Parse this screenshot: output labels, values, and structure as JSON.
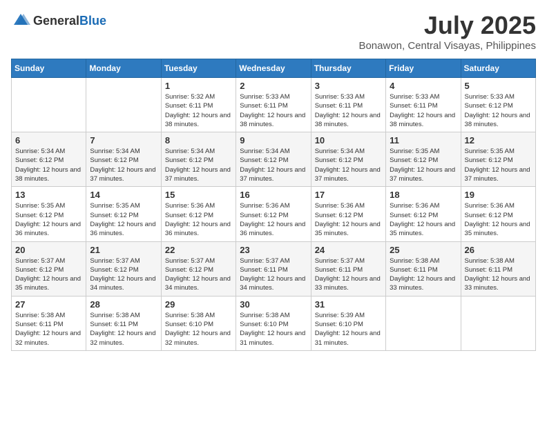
{
  "header": {
    "logo_general": "General",
    "logo_blue": "Blue",
    "title": "July 2025",
    "subtitle": "Bonawon, Central Visayas, Philippines"
  },
  "days_of_week": [
    "Sunday",
    "Monday",
    "Tuesday",
    "Wednesday",
    "Thursday",
    "Friday",
    "Saturday"
  ],
  "weeks": [
    [
      {
        "day": "",
        "sunrise": "",
        "sunset": "",
        "daylight": ""
      },
      {
        "day": "",
        "sunrise": "",
        "sunset": "",
        "daylight": ""
      },
      {
        "day": "1",
        "sunrise": "Sunrise: 5:32 AM",
        "sunset": "Sunset: 6:11 PM",
        "daylight": "Daylight: 12 hours and 38 minutes."
      },
      {
        "day": "2",
        "sunrise": "Sunrise: 5:33 AM",
        "sunset": "Sunset: 6:11 PM",
        "daylight": "Daylight: 12 hours and 38 minutes."
      },
      {
        "day": "3",
        "sunrise": "Sunrise: 5:33 AM",
        "sunset": "Sunset: 6:11 PM",
        "daylight": "Daylight: 12 hours and 38 minutes."
      },
      {
        "day": "4",
        "sunrise": "Sunrise: 5:33 AM",
        "sunset": "Sunset: 6:11 PM",
        "daylight": "Daylight: 12 hours and 38 minutes."
      },
      {
        "day": "5",
        "sunrise": "Sunrise: 5:33 AM",
        "sunset": "Sunset: 6:12 PM",
        "daylight": "Daylight: 12 hours and 38 minutes."
      }
    ],
    [
      {
        "day": "6",
        "sunrise": "Sunrise: 5:34 AM",
        "sunset": "Sunset: 6:12 PM",
        "daylight": "Daylight: 12 hours and 38 minutes."
      },
      {
        "day": "7",
        "sunrise": "Sunrise: 5:34 AM",
        "sunset": "Sunset: 6:12 PM",
        "daylight": "Daylight: 12 hours and 37 minutes."
      },
      {
        "day": "8",
        "sunrise": "Sunrise: 5:34 AM",
        "sunset": "Sunset: 6:12 PM",
        "daylight": "Daylight: 12 hours and 37 minutes."
      },
      {
        "day": "9",
        "sunrise": "Sunrise: 5:34 AM",
        "sunset": "Sunset: 6:12 PM",
        "daylight": "Daylight: 12 hours and 37 minutes."
      },
      {
        "day": "10",
        "sunrise": "Sunrise: 5:34 AM",
        "sunset": "Sunset: 6:12 PM",
        "daylight": "Daylight: 12 hours and 37 minutes."
      },
      {
        "day": "11",
        "sunrise": "Sunrise: 5:35 AM",
        "sunset": "Sunset: 6:12 PM",
        "daylight": "Daylight: 12 hours and 37 minutes."
      },
      {
        "day": "12",
        "sunrise": "Sunrise: 5:35 AM",
        "sunset": "Sunset: 6:12 PM",
        "daylight": "Daylight: 12 hours and 37 minutes."
      }
    ],
    [
      {
        "day": "13",
        "sunrise": "Sunrise: 5:35 AM",
        "sunset": "Sunset: 6:12 PM",
        "daylight": "Daylight: 12 hours and 36 minutes."
      },
      {
        "day": "14",
        "sunrise": "Sunrise: 5:35 AM",
        "sunset": "Sunset: 6:12 PM",
        "daylight": "Daylight: 12 hours and 36 minutes."
      },
      {
        "day": "15",
        "sunrise": "Sunrise: 5:36 AM",
        "sunset": "Sunset: 6:12 PM",
        "daylight": "Daylight: 12 hours and 36 minutes."
      },
      {
        "day": "16",
        "sunrise": "Sunrise: 5:36 AM",
        "sunset": "Sunset: 6:12 PM",
        "daylight": "Daylight: 12 hours and 36 minutes."
      },
      {
        "day": "17",
        "sunrise": "Sunrise: 5:36 AM",
        "sunset": "Sunset: 6:12 PM",
        "daylight": "Daylight: 12 hours and 35 minutes."
      },
      {
        "day": "18",
        "sunrise": "Sunrise: 5:36 AM",
        "sunset": "Sunset: 6:12 PM",
        "daylight": "Daylight: 12 hours and 35 minutes."
      },
      {
        "day": "19",
        "sunrise": "Sunrise: 5:36 AM",
        "sunset": "Sunset: 6:12 PM",
        "daylight": "Daylight: 12 hours and 35 minutes."
      }
    ],
    [
      {
        "day": "20",
        "sunrise": "Sunrise: 5:37 AM",
        "sunset": "Sunset: 6:12 PM",
        "daylight": "Daylight: 12 hours and 35 minutes."
      },
      {
        "day": "21",
        "sunrise": "Sunrise: 5:37 AM",
        "sunset": "Sunset: 6:12 PM",
        "daylight": "Daylight: 12 hours and 34 minutes."
      },
      {
        "day": "22",
        "sunrise": "Sunrise: 5:37 AM",
        "sunset": "Sunset: 6:12 PM",
        "daylight": "Daylight: 12 hours and 34 minutes."
      },
      {
        "day": "23",
        "sunrise": "Sunrise: 5:37 AM",
        "sunset": "Sunset: 6:11 PM",
        "daylight": "Daylight: 12 hours and 34 minutes."
      },
      {
        "day": "24",
        "sunrise": "Sunrise: 5:37 AM",
        "sunset": "Sunset: 6:11 PM",
        "daylight": "Daylight: 12 hours and 33 minutes."
      },
      {
        "day": "25",
        "sunrise": "Sunrise: 5:38 AM",
        "sunset": "Sunset: 6:11 PM",
        "daylight": "Daylight: 12 hours and 33 minutes."
      },
      {
        "day": "26",
        "sunrise": "Sunrise: 5:38 AM",
        "sunset": "Sunset: 6:11 PM",
        "daylight": "Daylight: 12 hours and 33 minutes."
      }
    ],
    [
      {
        "day": "27",
        "sunrise": "Sunrise: 5:38 AM",
        "sunset": "Sunset: 6:11 PM",
        "daylight": "Daylight: 12 hours and 32 minutes."
      },
      {
        "day": "28",
        "sunrise": "Sunrise: 5:38 AM",
        "sunset": "Sunset: 6:11 PM",
        "daylight": "Daylight: 12 hours and 32 minutes."
      },
      {
        "day": "29",
        "sunrise": "Sunrise: 5:38 AM",
        "sunset": "Sunset: 6:10 PM",
        "daylight": "Daylight: 12 hours and 32 minutes."
      },
      {
        "day": "30",
        "sunrise": "Sunrise: 5:38 AM",
        "sunset": "Sunset: 6:10 PM",
        "daylight": "Daylight: 12 hours and 31 minutes."
      },
      {
        "day": "31",
        "sunrise": "Sunrise: 5:39 AM",
        "sunset": "Sunset: 6:10 PM",
        "daylight": "Daylight: 12 hours and 31 minutes."
      },
      {
        "day": "",
        "sunrise": "",
        "sunset": "",
        "daylight": ""
      },
      {
        "day": "",
        "sunrise": "",
        "sunset": "",
        "daylight": ""
      }
    ]
  ]
}
